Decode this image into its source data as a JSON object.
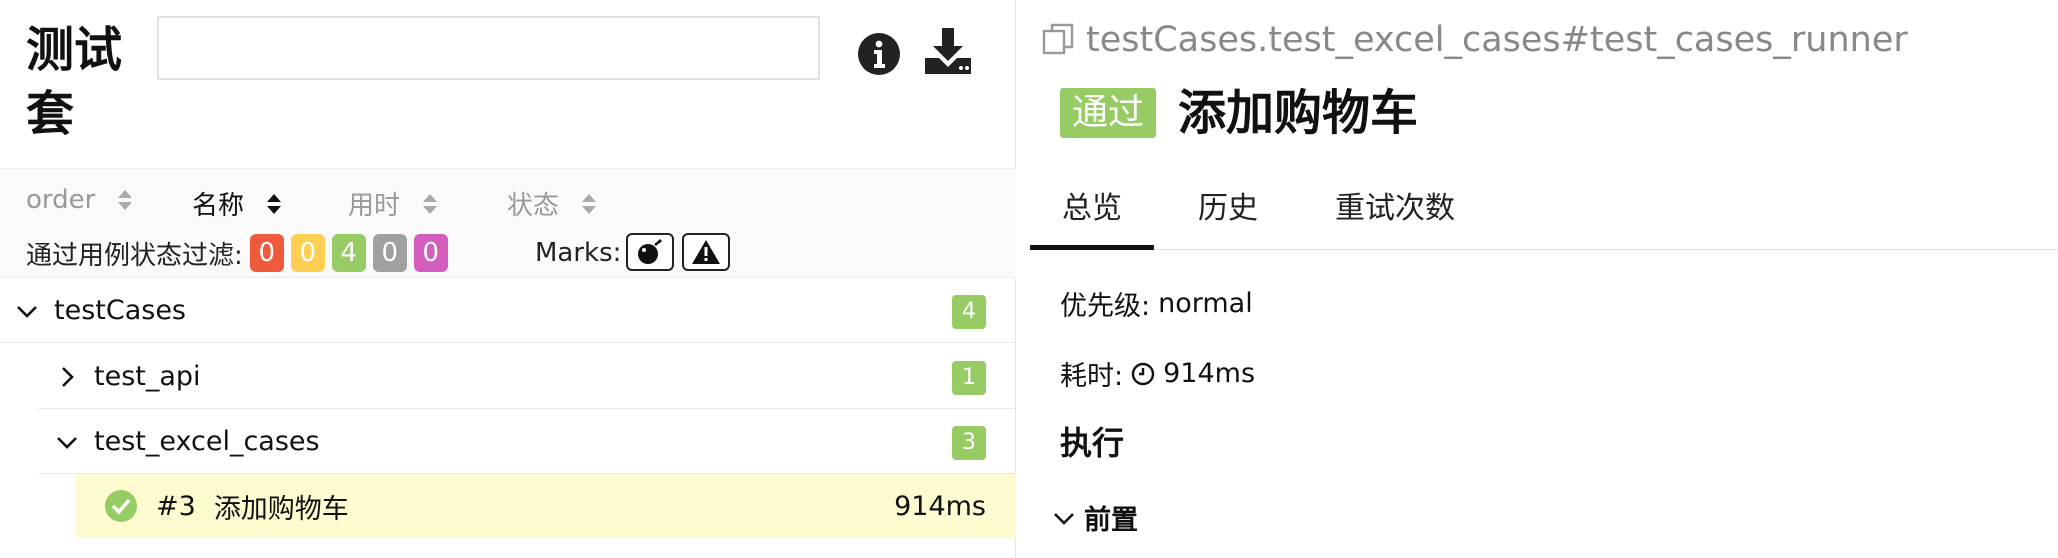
{
  "left": {
    "title": "测试套",
    "search": {
      "value": "",
      "placeholder": ""
    },
    "icons": {
      "info": "info-icon",
      "download": "download-icon"
    },
    "sort_columns": [
      {
        "label": "order",
        "active": false
      },
      {
        "label": "名称",
        "active": true
      },
      {
        "label": "用时",
        "active": false
      },
      {
        "label": "状态",
        "active": false
      }
    ],
    "filter_label": "通过用例状态过滤:",
    "status_badges": [
      {
        "value": "0",
        "color": "#f05a3c"
      },
      {
        "value": "0",
        "color": "#fecf52"
      },
      {
        "value": "4",
        "color": "#97cc64"
      },
      {
        "value": "0",
        "color": "#a0a0a0"
      },
      {
        "value": "0",
        "color": "#d35ebe"
      }
    ],
    "marks_label": "Marks:",
    "marks": [
      "flaky-icon",
      "warning-icon"
    ],
    "tree": {
      "root": {
        "name": "testCases",
        "count": "4"
      },
      "group1": {
        "name": "test_api",
        "count": "1"
      },
      "group2": {
        "name": "test_excel_cases",
        "count": "3"
      },
      "case": {
        "number": "#3",
        "name": "添加购物车",
        "duration": "914ms",
        "status": "passed"
      }
    }
  },
  "right": {
    "path": "testCases.test_excel_cases#test_cases_runner",
    "status_tag": "通过",
    "title": "添加购物车",
    "tabs": [
      "总览",
      "历史",
      "重试次数"
    ],
    "active_tab": "总览",
    "priority_label": "优先级:",
    "priority_value": "normal",
    "duration_label": "耗时:",
    "duration_value": "914ms",
    "execution_heading": "执行",
    "setup_heading": "前置"
  },
  "colors": {
    "passed": "#97cc64",
    "highlight_row": "#fffbd0"
  }
}
